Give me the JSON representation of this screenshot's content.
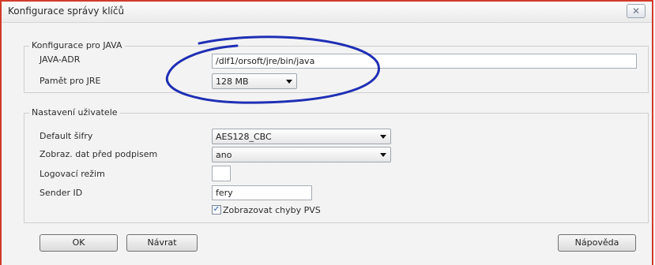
{
  "window": {
    "title": "Konfigurace správy klíčů",
    "close_icon": "close-icon"
  },
  "java_group": {
    "legend": "Konfigurace pro JAVA",
    "java_adr_label": "JAVA-ADR",
    "java_adr_value": "/dlf1/orsoft/jre/bin/java",
    "memory_label": "Pamět pro JRE",
    "memory_value": "128 MB"
  },
  "user_group": {
    "legend": "Nastavení uživatele",
    "cipher_label": "Default šifry",
    "cipher_value": "AES128_CBC",
    "display_label": "Zobraz. dat před podpisem",
    "display_value": "ano",
    "log_label": "Logovací režim",
    "log_value": "",
    "sender_label": "Sender ID",
    "sender_value": "fery",
    "show_errors_label": "Zobrazovat chyby PVS",
    "show_errors_checked": true
  },
  "buttons": {
    "ok": "OK",
    "back": "Návrat",
    "help": "Nápověda"
  },
  "colors": {
    "window_border": "#d23a2a",
    "annotation": "#1f2fb5"
  }
}
